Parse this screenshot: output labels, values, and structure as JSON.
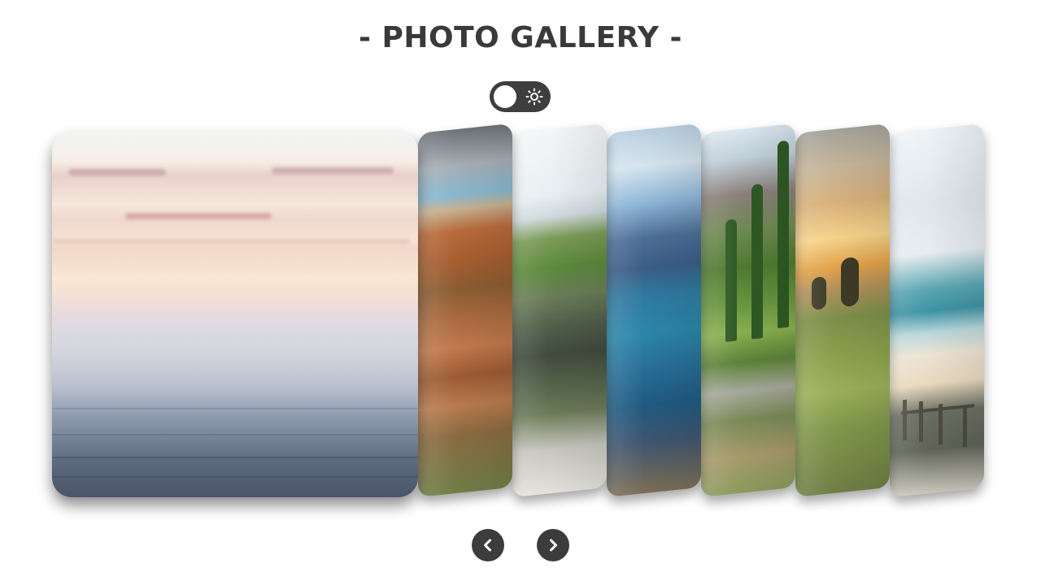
{
  "header": {
    "title": "- PHOTO GALLERY -"
  },
  "theme_toggle": {
    "icon": "sun-icon",
    "state": "off"
  },
  "gallery": {
    "slides": [
      {
        "name": "misty-sea-sunrise",
        "active": true
      },
      {
        "name": "red-rock-cliffs",
        "active": false
      },
      {
        "name": "green-sea-cliff",
        "active": false
      },
      {
        "name": "blue-fjord",
        "active": false
      },
      {
        "name": "pine-forest-mountain",
        "active": false
      },
      {
        "name": "sunset-savanna-trees",
        "active": false
      },
      {
        "name": "beach-boardwalk",
        "active": false
      }
    ]
  },
  "navigation": {
    "prev_icon": "chevron-left-icon",
    "next_icon": "chevron-right-icon"
  },
  "colors": {
    "text": "#3a3a3a",
    "button_bg": "#3c3c3c",
    "toggle_bg": "#3e3e3e"
  }
}
